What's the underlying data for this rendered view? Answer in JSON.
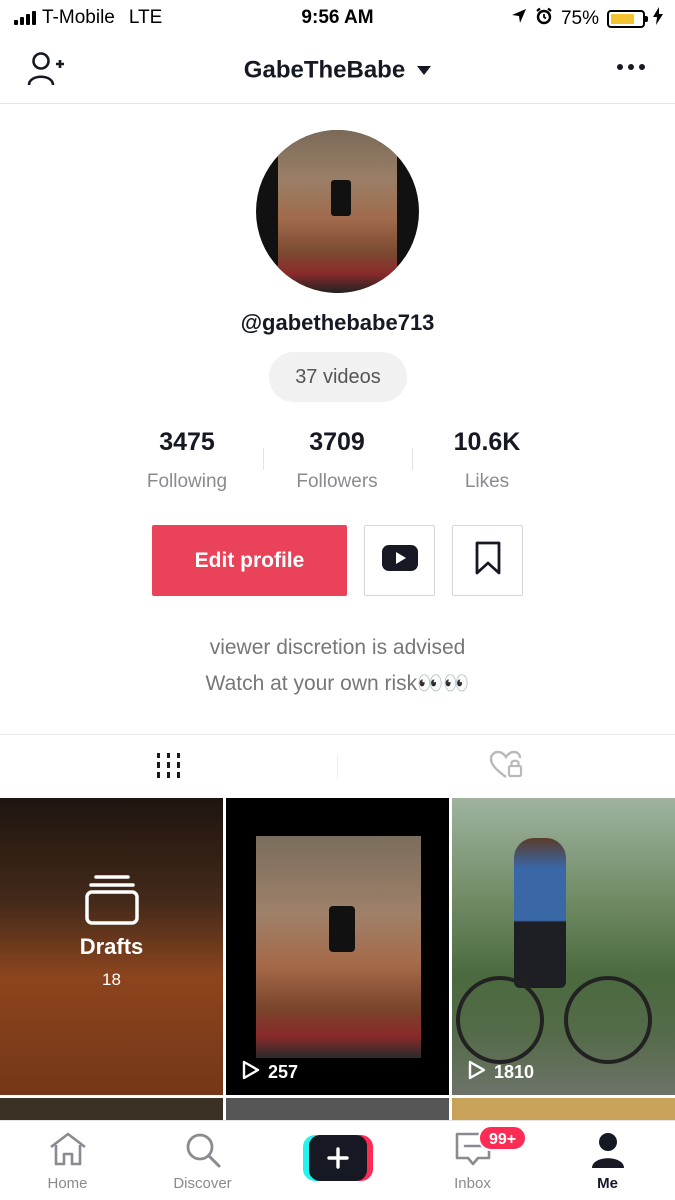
{
  "status_bar": {
    "carrier": "T-Mobile",
    "network": "LTE",
    "time": "9:56 AM",
    "battery": "75%",
    "battery_level": 0.75
  },
  "header": {
    "title": "GabeTheBabe",
    "icons": [
      "add-user-icon",
      "chevron-down-icon",
      "more-icon"
    ]
  },
  "profile": {
    "handle": "@gabethebabe713",
    "video_count": "37 videos",
    "stats": [
      {
        "value": "3475",
        "label": "Following"
      },
      {
        "value": "3709",
        "label": "Followers"
      },
      {
        "value": "10.6K",
        "label": "Likes"
      }
    ],
    "edit_button": "Edit profile",
    "bio_line1": "viewer discretion is advised",
    "bio_line2": "Watch at your own risk👀👀"
  },
  "tabs": {
    "icons": [
      "videos-grid-icon",
      "liked-private-icon"
    ]
  },
  "grid": {
    "drafts_label": "Drafts",
    "drafts_count": "18",
    "items": [
      {
        "views": "257"
      },
      {
        "views": "1810"
      }
    ]
  },
  "bottom_nav": {
    "items": [
      {
        "label": "Home",
        "icon": "home-icon"
      },
      {
        "label": "Discover",
        "icon": "search-icon"
      },
      {
        "label": "",
        "icon": "plus-icon"
      },
      {
        "label": "Inbox",
        "icon": "inbox-icon"
      },
      {
        "label": "Me",
        "icon": "person-icon"
      }
    ],
    "inbox_badge": "99+"
  },
  "colors": {
    "accent": "#ea4359",
    "text": "#161823",
    "secondary": "#8a8b91",
    "battery": "#f4c430"
  }
}
